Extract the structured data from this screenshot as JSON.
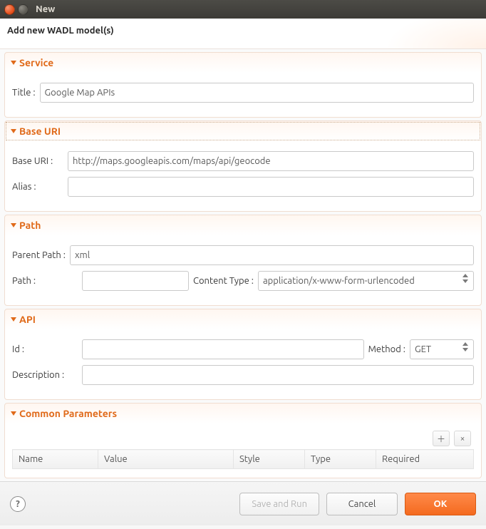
{
  "window": {
    "title": "New"
  },
  "header": {
    "text": "Add new WADL model(s)"
  },
  "sections": {
    "service": {
      "heading": "Service",
      "title_label": "Title :",
      "title_value": "Google Map APIs"
    },
    "base_uri": {
      "heading": "Base URI",
      "uri_label": "Base URI  :",
      "uri_value": "http://maps.googleapis.com/maps/api/geocode",
      "alias_label": "Alias :",
      "alias_value": ""
    },
    "path": {
      "heading": "Path",
      "parent_label": "Parent Path :",
      "parent_value": "xml",
      "path_label": "Path :",
      "path_value": "",
      "ctype_label": "Content Type :",
      "ctype_value": "application/x-www-form-urlencoded"
    },
    "api": {
      "heading": "API",
      "id_label": "Id :",
      "id_value": "",
      "method_label": "Method :",
      "method_value": "GET",
      "desc_label": "Description :",
      "desc_value": ""
    },
    "common_params": {
      "heading": "Common Parameters",
      "columns": {
        "name": "Name",
        "value": "Value",
        "style": "Style",
        "type": "Type",
        "required": "Required"
      }
    }
  },
  "footer": {
    "save_run": "Save and Run",
    "cancel": "Cancel",
    "ok": "OK"
  }
}
